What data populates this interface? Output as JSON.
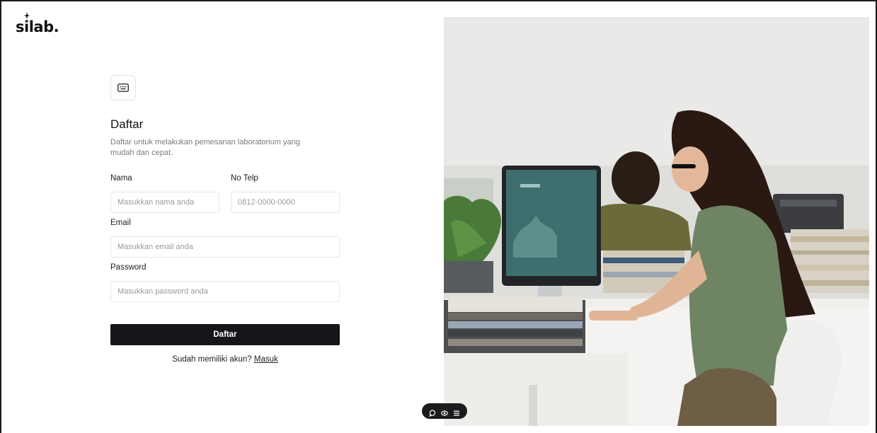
{
  "brand": {
    "logo_text": "silab."
  },
  "form": {
    "title": "Daftar",
    "subtitle": "Daftar untuk melakukan pemesanan laboratorium yang mudah dan cepat.",
    "name": {
      "label": "Nama",
      "placeholder": "Masukkan nama anda"
    },
    "phone": {
      "label": "No Telp",
      "placeholder": "0812-0000-0000"
    },
    "email": {
      "label": "Email",
      "placeholder": "Masukkan email anda"
    },
    "password": {
      "label": "Password",
      "placeholder": "Masukkan password anda"
    },
    "submit_label": "Daftar",
    "login_prompt": "Sudah memiliki akun?",
    "login_link": "Masuk"
  },
  "icons": {
    "header_badge": "keyboard-icon",
    "toolbar": [
      "comment-icon",
      "eye-icon",
      "list-icon"
    ]
  },
  "colors": {
    "button": "#15161a",
    "text": "#111111",
    "muted": "#7a7a7a"
  }
}
